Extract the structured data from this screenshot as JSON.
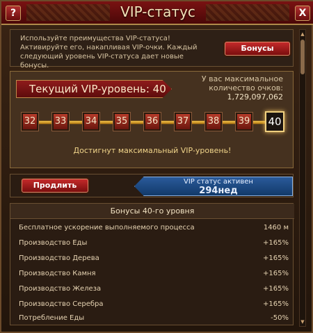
{
  "window": {
    "title": "VIP-статус",
    "help_label": "?",
    "close_label": "X"
  },
  "info": {
    "text": "Используйте преимущества VIP-статуса! Активируйте его, накапливая VIP-очки. Каждый следующий уровень VIP-статуса дает новые бонусы.",
    "bonus_button": "Бонусы"
  },
  "level": {
    "current_label": "Текущий VIP-уровень: 40",
    "max_points_label": "У вас максимальное количество очков:",
    "max_points_value": "1,729,097,062",
    "levels": [
      "32",
      "33",
      "34",
      "35",
      "36",
      "37",
      "38",
      "39",
      "40"
    ],
    "current_level": "40",
    "max_reached_message": "Достигнут максимальный VIP-уровень!"
  },
  "status": {
    "extend_button": "Продлить",
    "active_label": "VIP статус активен",
    "duration": "294нед"
  },
  "bonuses": {
    "header": "Бонусы 40-го уровня",
    "rows": [
      {
        "name": "Бесплатное ускорение выполняемого процесса",
        "value": "1460 м"
      },
      {
        "name": "Производство Еды",
        "value": "+165%"
      },
      {
        "name": "Производство Дерева",
        "value": "+165%"
      },
      {
        "name": "Производство Камня",
        "value": "+165%"
      },
      {
        "name": "Производство Железа",
        "value": "+165%"
      },
      {
        "name": "Производство Серебра",
        "value": "+165%"
      },
      {
        "name": "Потребление Еды",
        "value": "-50%"
      }
    ]
  },
  "colors": {
    "title_bar": "#7a1212",
    "accent_gold": "#f0c04a",
    "status_blue": "#2a5a9a"
  }
}
